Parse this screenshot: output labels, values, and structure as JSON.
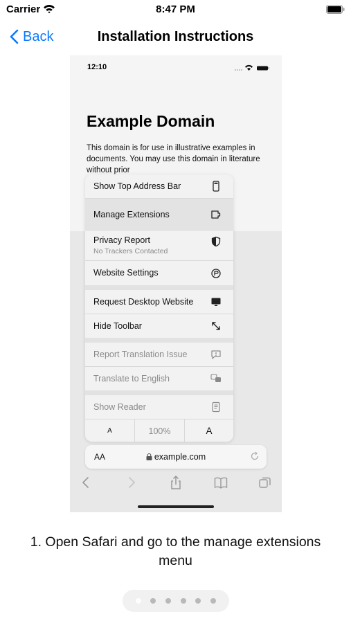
{
  "status_bar": {
    "carrier": "Carrier",
    "time": "8:47 PM"
  },
  "nav": {
    "back_label": "Back",
    "title": "Installation Instructions"
  },
  "tutorial_image": {
    "status_time": "12:10",
    "page_heading": "Example Domain",
    "page_body": "This domain is for use in illustrative examples in documents. You may use this domain in literature without prior",
    "menu": {
      "show_top_address_bar": "Show Top Address Bar",
      "manage_extensions": "Manage Extensions",
      "privacy_report": "Privacy Report",
      "privacy_report_sub": "No Trackers Contacted",
      "website_settings": "Website Settings",
      "request_desktop_website": "Request Desktop Website",
      "hide_toolbar": "Hide Toolbar",
      "report_translation_issue": "Report Translation Issue",
      "translate_to_english": "Translate to English",
      "show_reader": "Show Reader",
      "zoom_small": "A",
      "zoom_level": "100%",
      "zoom_large": "A"
    },
    "address_bar": {
      "text_size_label": "AA",
      "url": "example.com"
    }
  },
  "instruction": "1. Open Safari and go to the manage extensions menu",
  "pager": {
    "count": 6,
    "active_index": 0
  },
  "colors": {
    "accent": "#0a7aff",
    "highlight": "#e3e3e3"
  }
}
